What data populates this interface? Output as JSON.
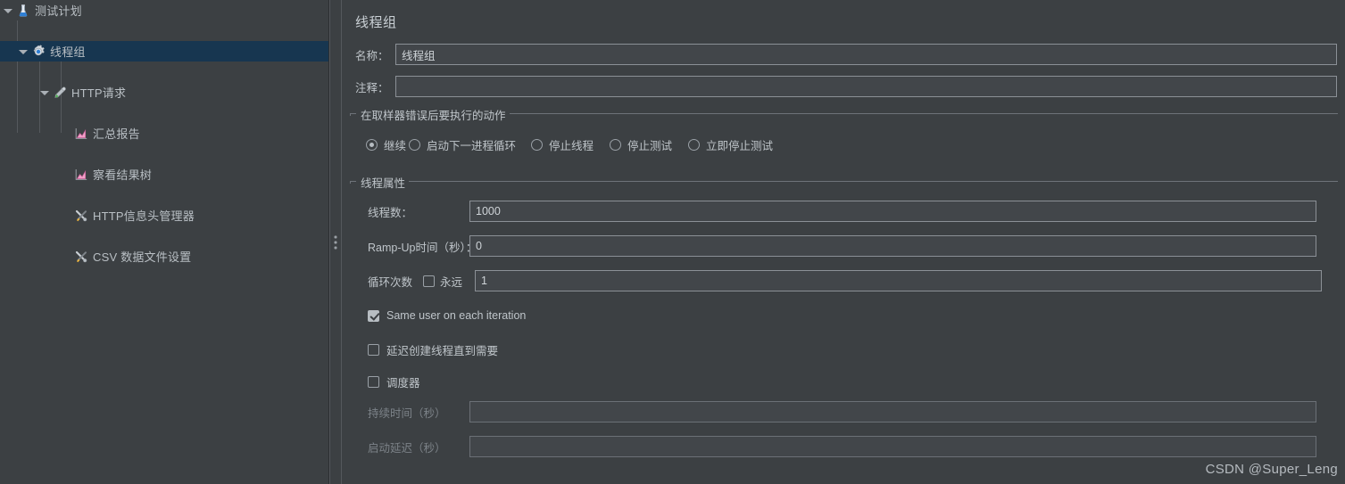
{
  "tree": {
    "items": [
      {
        "label": "测试计划",
        "icon": "flask-icon",
        "depth": 0,
        "expanded": true,
        "selected": false
      },
      {
        "label": "线程组",
        "icon": "gear-icon",
        "depth": 1,
        "expanded": true,
        "selected": true
      },
      {
        "label": "HTTP请求",
        "icon": "pipette-icon",
        "depth": 2,
        "expanded": true,
        "selected": false
      },
      {
        "label": "汇总报告",
        "icon": "chart-icon",
        "depth": 3,
        "expanded": false,
        "selected": false
      },
      {
        "label": "察看结果树",
        "icon": "chart-icon",
        "depth": 3,
        "expanded": false,
        "selected": false
      },
      {
        "label": "HTTP信息头管理器",
        "icon": "tools-icon",
        "depth": 3,
        "expanded": false,
        "selected": false
      },
      {
        "label": "CSV 数据文件设置",
        "icon": "tools-icon",
        "depth": 3,
        "expanded": false,
        "selected": false
      }
    ]
  },
  "panel": {
    "title": "线程组",
    "name_label": "名称：",
    "name_value": "线程组",
    "comment_label": "注释：",
    "comment_value": "",
    "comment_placeholder": ""
  },
  "error_action": {
    "title": "在取样器错误后要执行的动作",
    "options": [
      {
        "label": "继续",
        "checked": true
      },
      {
        "label": "启动下一进程循环",
        "checked": false
      },
      {
        "label": "停止线程",
        "checked": false
      },
      {
        "label": "停止测试",
        "checked": false
      },
      {
        "label": "立即停止测试",
        "checked": false
      }
    ]
  },
  "thread_props": {
    "title": "线程属性",
    "threads_label": "线程数：",
    "threads_value": "1000",
    "rampup_label": "Ramp-Up时间（秒）：",
    "rampup_value": "0",
    "loop_label": "循环次数",
    "forever_label": "永远",
    "forever_checked": false,
    "loop_value": "1",
    "same_user_label": "Same user on each iteration",
    "same_user_checked": true,
    "delay_create_label": "延迟创建线程直到需要",
    "delay_create_checked": false,
    "scheduler_label": "调度器",
    "scheduler_checked": false,
    "duration_label": "持续时间（秒）",
    "duration_value": "",
    "startup_delay_label": "启动延迟（秒）",
    "startup_delay_value": ""
  },
  "watermark": "CSDN @Super_Leng",
  "colors": {
    "background": "#3c4043",
    "selection": "#173650",
    "text": "#bfc5ca",
    "border": "#8b9096"
  }
}
